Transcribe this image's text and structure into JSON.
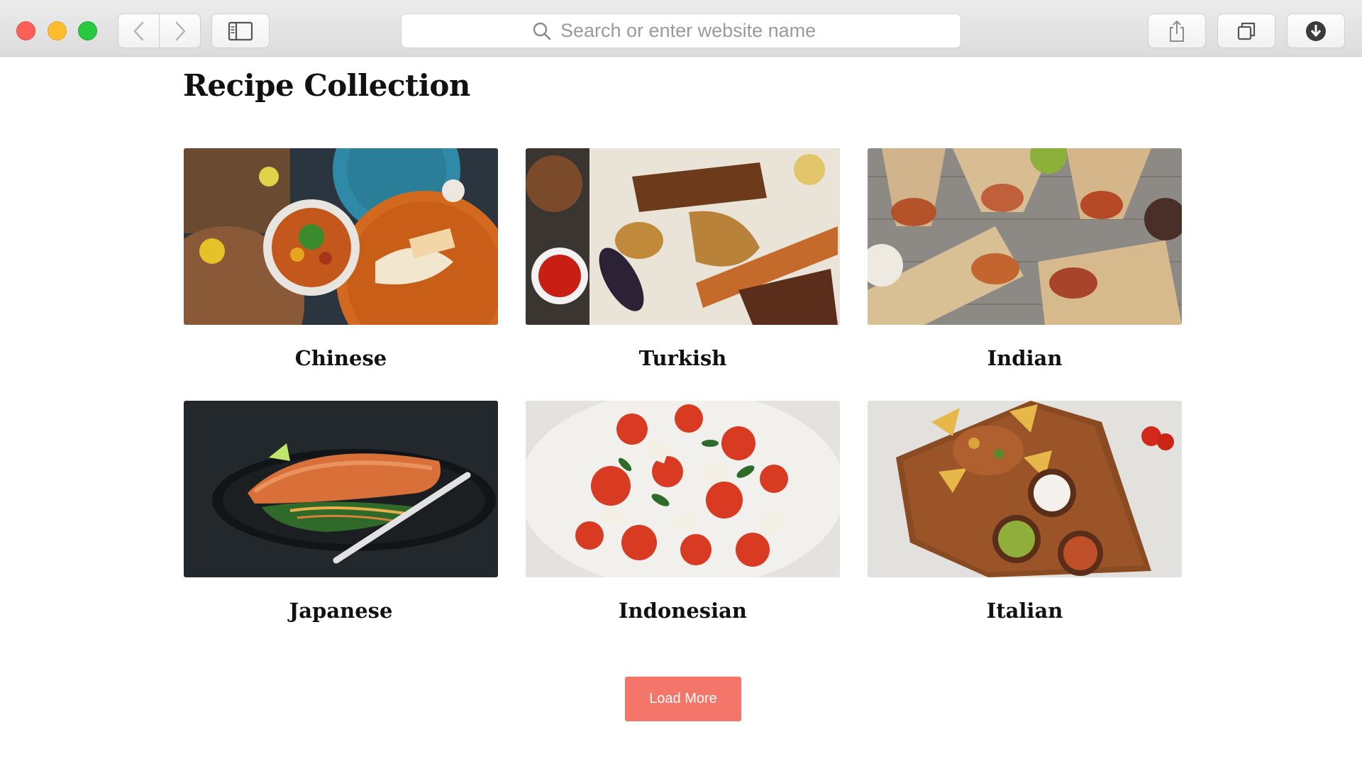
{
  "browser": {
    "address_placeholder": "Search or enter website name",
    "icons": {
      "back": "chevron-left-icon",
      "forward": "chevron-right-icon",
      "sidebar": "sidebar-icon",
      "search": "search-icon",
      "share": "share-icon",
      "tabs": "tabs-icon",
      "download": "download-icon"
    },
    "traffic_colors": {
      "close": "#fd5f57",
      "minimize": "#febc2e",
      "maximize": "#28c840"
    }
  },
  "page": {
    "title": "Recipe Collection",
    "recipes": [
      {
        "label": "Chinese",
        "image": "chinese-food-photo"
      },
      {
        "label": "Turkish",
        "image": "turkish-kebab-photo"
      },
      {
        "label": "Indian",
        "image": "indian-wraps-photo"
      },
      {
        "label": "Japanese",
        "image": "salmon-plate-photo"
      },
      {
        "label": "Indonesian",
        "image": "tomato-salad-photo"
      },
      {
        "label": "Italian",
        "image": "nachos-board-photo"
      }
    ],
    "load_more_label": "Load More",
    "accent_color": "#f4756a"
  }
}
